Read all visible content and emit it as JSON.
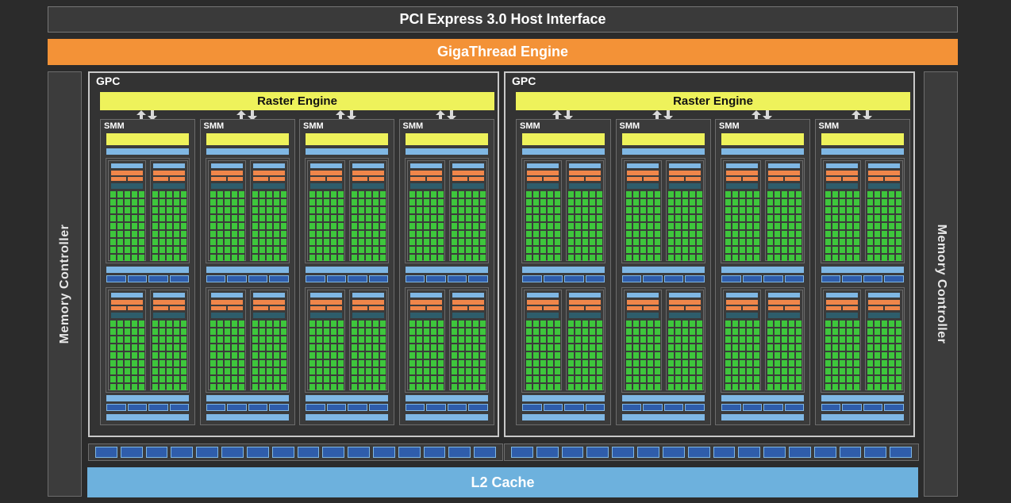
{
  "host_interface": "PCI Express 3.0 Host Interface",
  "gigathread": "GigaThread Engine",
  "memory_controller": "Memory Controller",
  "l2_cache": "L2 Cache",
  "gpcs": [
    {
      "title": "GPC",
      "raster": "Raster Engine",
      "smms": [
        "SMM",
        "SMM",
        "SMM",
        "SMM"
      ]
    },
    {
      "title": "GPC",
      "raster": "Raster Engine",
      "smms": [
        "SMM",
        "SMM",
        "SMM",
        "SMM"
      ]
    }
  ],
  "colors": {
    "background": "#2b2b2b",
    "gigathread": "#f39237",
    "raster": "#eef25b",
    "l2": "#6db1dd",
    "core": "#3ec63c",
    "block_blue": "#7fb7e4",
    "block_orange": "#f0864a",
    "block_teal": "#2e5d6b",
    "block_dark_blue": "#2f5dab"
  }
}
